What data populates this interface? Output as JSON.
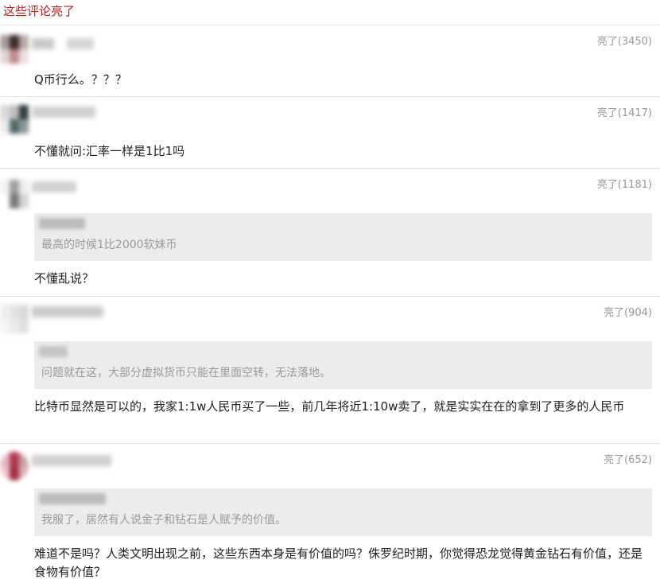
{
  "section": {
    "title": "这些评论亮了"
  },
  "comments": [
    {
      "likes": "亮了(3450)",
      "text": "Q币行么。？？？"
    },
    {
      "likes": "亮了(1417)",
      "text": "不懂就问:汇率一样是1比1吗"
    },
    {
      "likes": "亮了(1181)",
      "quote": "最高的时候1比2000软妹币",
      "text": "不懂乱说？"
    },
    {
      "likes": "亮了(904)",
      "quote": "问题就在这，大部分虚拟货币只能在里面空转，无法落地。",
      "text": "比特币显然是可以的，我家1:1w人民币买了一些，前几年将近1:10w卖了，就是实实在在的拿到了更多的人民币"
    },
    {
      "likes": "亮了(652)",
      "quote": "我服了，居然有人说金子和钻石是人赋予的价值。",
      "text": "难道不是吗？人类文明出现之前，这些东西本身是有价值的吗？侏罗纪时期，你觉得恐龙觉得黄金钻石有价值，还是食物有价值？"
    }
  ]
}
